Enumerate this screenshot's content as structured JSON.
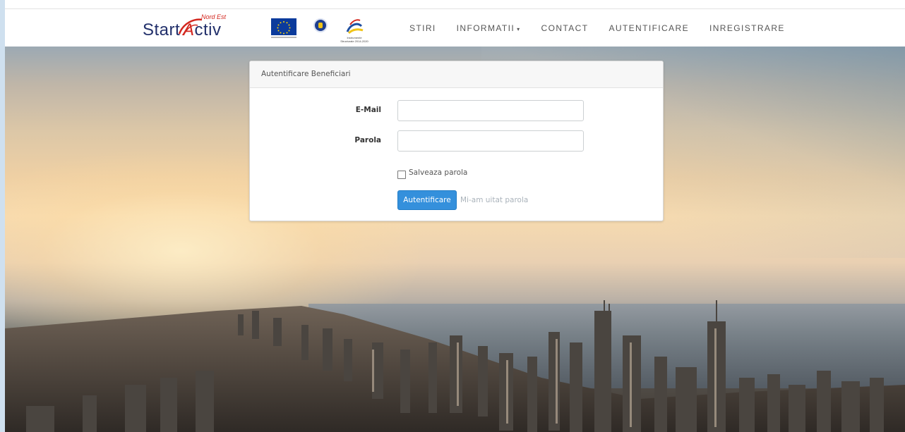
{
  "brand": {
    "logo_start": "Start",
    "logo_a": "A",
    "logo_ctiv": "ctiv",
    "logo_nord_est": "Nord Est",
    "partner_logos": [
      "eu-flag-logo",
      "romanian-government-seal-logo",
      "instrumente-structurale-logo"
    ],
    "partner_caption": "Instrumente Structurale 2014-2020"
  },
  "nav": {
    "items": [
      {
        "label": "STIRI",
        "has_dropdown": false
      },
      {
        "label": "INFORMATII",
        "has_dropdown": true
      },
      {
        "label": "CONTACT",
        "has_dropdown": false
      },
      {
        "label": "AUTENTIFICARE",
        "has_dropdown": false
      },
      {
        "label": "INREGISTRARE",
        "has_dropdown": false
      }
    ],
    "caret": "▾"
  },
  "login_card": {
    "title": "Autentificare Beneficiari",
    "email_label": "E-Mail",
    "email_value": "",
    "password_label": "Parola",
    "password_value": "",
    "remember_label": "Salveaza parola",
    "remember_checked": false,
    "submit_label": "Autentificare",
    "forgot_label": "Mi-am uitat parola"
  },
  "colors": {
    "brand_navy": "#22306b",
    "brand_red": "#d3271f",
    "primary_button": "#3490dc",
    "muted_link": "#aab3bb"
  },
  "background": {
    "icon": "city-skyline-sunset-photo"
  }
}
